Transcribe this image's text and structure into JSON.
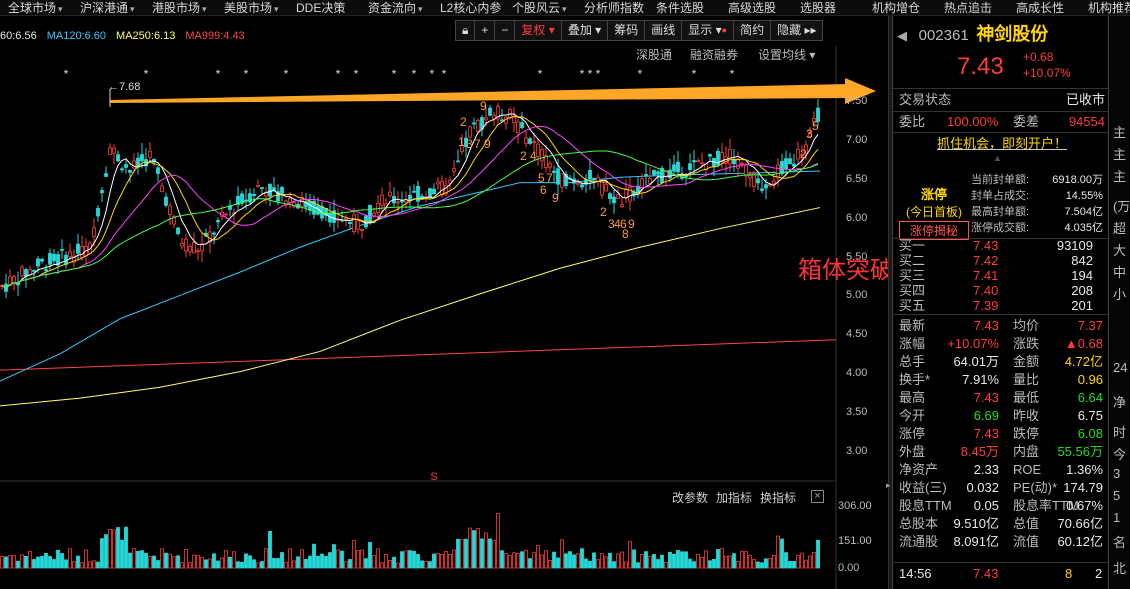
{
  "menu": [
    {
      "label": "全球市场",
      "arrow": true
    },
    {
      "label": "沪深港通",
      "arrow": true
    },
    {
      "label": "港股市场",
      "arrow": true
    },
    {
      "label": "美股市场",
      "arrow": true
    },
    {
      "label": "DDE决策",
      "arrow": false
    },
    {
      "label": "资金流向",
      "arrow": true
    },
    {
      "label": "L2核心内参",
      "arrow": false
    },
    {
      "label": "个股风云",
      "arrow": true
    },
    {
      "label": "分析师指数",
      "arrow": false
    },
    {
      "label": "条件选股",
      "arrow": false
    },
    {
      "label": "高级选股",
      "arrow": false
    },
    {
      "label": "选股器",
      "arrow": false
    },
    {
      "label": "机构增仓",
      "arrow": false
    },
    {
      "label": "热点追击",
      "arrow": false
    },
    {
      "label": "高成长性",
      "arrow": false
    },
    {
      "label": "机构推荐",
      "arrow": false
    }
  ],
  "ma_legend": [
    {
      "text": "60:6.56",
      "color": "#e8e8e8"
    },
    {
      "text": "MA120:6.60",
      "color": "#38c8ff"
    },
    {
      "text": "MA250:6.13",
      "color": "#ffff66"
    },
    {
      "text": "MA999:4.43",
      "color": "#ff4444"
    }
  ],
  "toolbar": {
    "adjust": "复权",
    "overlay": "叠加",
    "chips": "筹码",
    "draw": "画线",
    "display": "显示",
    "simple": "简约",
    "hide": "隐藏"
  },
  "sublinks": {
    "sh_sz": "深股通",
    "margin": "融资融券",
    "ma_setting": "设置均线"
  },
  "price_axis": [
    "7.50",
    "7.00",
    "6.50",
    "6.00",
    "5.50",
    "5.00",
    "4.50",
    "4.00",
    "3.50",
    "3.00"
  ],
  "peak_label": "7.68",
  "annotation": "箱体突破",
  "volume": {
    "links": [
      "改参数",
      "加指标",
      "换指标"
    ],
    "axis": [
      "306.00",
      "151.00",
      "0.00"
    ]
  },
  "colors": {
    "up": "#ff3b3b",
    "down": "#26d926",
    "flat": "#e8e8e8",
    "accent": "#ffd600",
    "arrow": "#ffa528"
  },
  "stock": {
    "code": "002361",
    "name": "神剑股份",
    "price": "7.43",
    "change": "+0.68",
    "change_pct": "+10.07%"
  },
  "status": {
    "label": "交易状态",
    "value": "已收市"
  },
  "ratio": {
    "label1": "委比",
    "value1": "100.00%",
    "label2": "委差",
    "value2": "94554"
  },
  "promo": "抓住机会，即刻开户！",
  "limit_up": {
    "title": "涨停",
    "subtitle": "(今日首板)",
    "reveal": "涨停揭秘",
    "rows": [
      {
        "label": "当前封单额:",
        "value": "6918.00万"
      },
      {
        "label": "封单占成交:",
        "value": "14.55%"
      },
      {
        "label": "最高封单额:",
        "value": "7.504亿"
      },
      {
        "label": "涨停成交额:",
        "value": "4.035亿"
      }
    ]
  },
  "order_book": [
    {
      "label": "买一",
      "price": "7.43",
      "volume": "93109"
    },
    {
      "label": "买二",
      "price": "7.42",
      "volume": "842"
    },
    {
      "label": "买三",
      "price": "7.41",
      "volume": "194"
    },
    {
      "label": "买四",
      "price": "7.40",
      "volume": "208"
    },
    {
      "label": "买五",
      "price": "7.39",
      "volume": "201"
    }
  ],
  "quote": [
    {
      "l1": "最新",
      "v1": "7.43",
      "c1": "red",
      "l2": "均价",
      "v2": "7.37",
      "c2": "red"
    },
    {
      "l1": "涨幅",
      "v1": "+10.07%",
      "c1": "red",
      "l2": "涨跌",
      "v2": "▲0.68",
      "c2": "red"
    },
    {
      "l1": "总手",
      "v1": "64.01万",
      "c1": "white",
      "l2": "金额",
      "v2": "4.72亿",
      "c2": "yellow"
    },
    {
      "l1": "换手*",
      "v1": "7.91%",
      "c1": "white",
      "l2": "量比",
      "v2": "0.96",
      "c2": "yellow"
    },
    {
      "l1": "最高",
      "v1": "7.43",
      "c1": "red",
      "l2": "最低",
      "v2": "6.64",
      "c2": "green"
    },
    {
      "l1": "今开",
      "v1": "6.69",
      "c1": "green",
      "l2": "昨收",
      "v2": "6.75",
      "c2": "white"
    },
    {
      "l1": "涨停",
      "v1": "7.43",
      "c1": "red",
      "l2": "跌停",
      "v2": "6.08",
      "c2": "green"
    },
    {
      "l1": "外盘",
      "v1": "8.45万",
      "c1": "red",
      "l2": "内盘",
      "v2": "55.56万",
      "c2": "green"
    },
    {
      "l1": "净资产",
      "v1": "2.33",
      "c1": "white",
      "l2": "ROE",
      "v2": "1.36%",
      "c2": "white"
    },
    {
      "l1": "收益(三)",
      "v1": "0.032",
      "c1": "white",
      "l2": "PE(动)*",
      "v2": "174.79",
      "c2": "white"
    },
    {
      "l1": "股息TTM",
      "v1": "0.05",
      "c1": "white",
      "l2": "股息率TTM",
      "v2": "0.67%",
      "c2": "white"
    },
    {
      "l1": "总股本",
      "v1": "9.510亿",
      "c1": "white",
      "l2": "总值",
      "v2": "70.66亿",
      "c2": "white"
    },
    {
      "l1": "流通股",
      "v1": "8.091亿",
      "c1": "white",
      "l2": "流值",
      "v2": "60.12亿",
      "c2": "white"
    }
  ],
  "tick": {
    "time": "14:56",
    "price": "7.43",
    "vol": "8",
    "count": "2"
  },
  "far_right": [
    "主",
    "主",
    "主",
    "(万元",
    "超",
    "大",
    "中",
    "小",
    "24",
    "净",
    "时",
    "今",
    "3",
    "5",
    "1",
    "名",
    "北"
  ]
}
